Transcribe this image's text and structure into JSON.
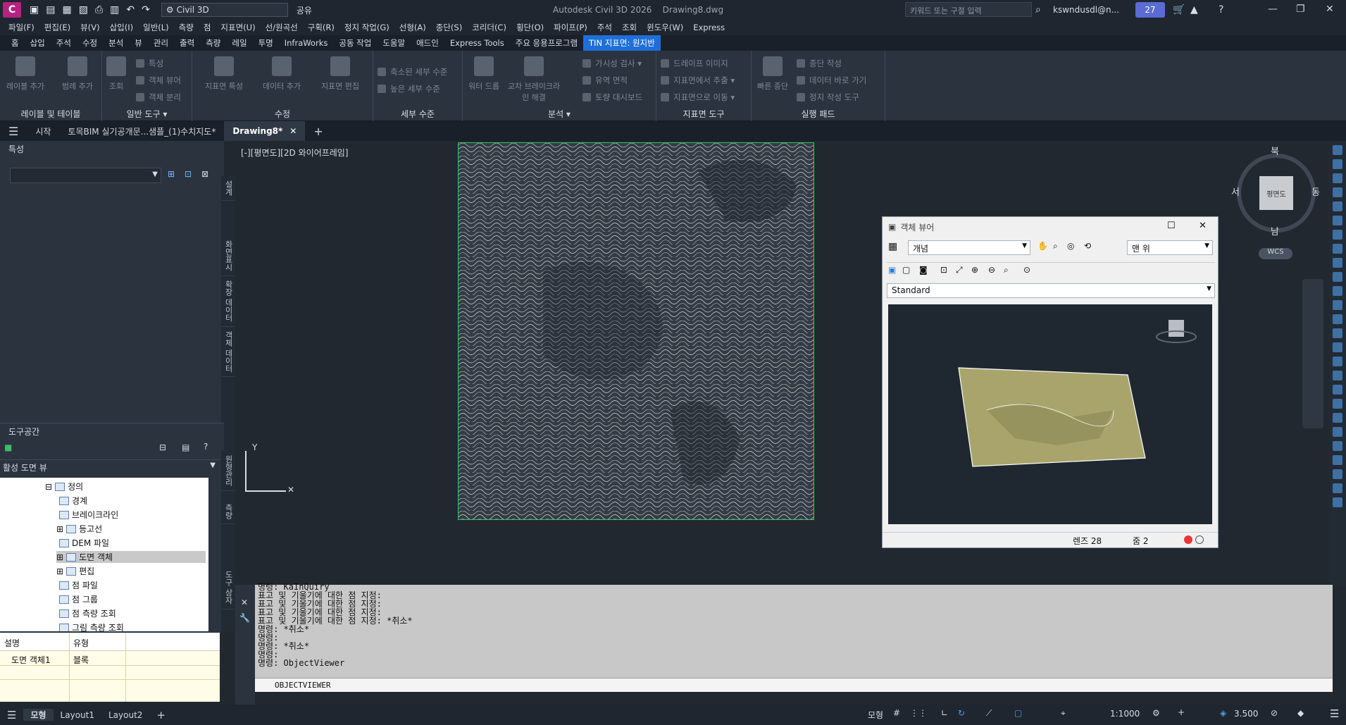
{
  "titlebar": {
    "logo": "C",
    "workspace": "Civil 3D",
    "share": "공유",
    "app_title": "Autodesk Civil 3D 2026",
    "doc_title": "Drawing8.dwg",
    "search_placeholder": "키워드 또는 구절 입력",
    "user": "kswndusdl@n...",
    "notifications": "27"
  },
  "menu": [
    "파일(F)",
    "편집(E)",
    "뷰(V)",
    "삽입(I)",
    "일반(L)",
    "측량",
    "점",
    "지표면(U)",
    "선/원곡선",
    "구획(R)",
    "정지 작업(G)",
    "선형(A)",
    "종단(S)",
    "코리더(C)",
    "횡단(O)",
    "파이프(P)",
    "주석",
    "조회",
    "윈도우(W)",
    "Express"
  ],
  "ribbon_tabs": [
    "홈",
    "삽입",
    "주석",
    "수정",
    "분석",
    "뷰",
    "관리",
    "출력",
    "측량",
    "레일",
    "투명",
    "InfraWorks",
    "공동 작업",
    "도움말",
    "애드인",
    "Express Tools",
    "주요 응용프로그램",
    "TIN 지표면: 원지반"
  ],
  "ribbon": {
    "p1": {
      "title": "레이블 및 테이블",
      "b1": "레이블 추가",
      "b2": "범례 추가"
    },
    "p2": {
      "title": "일반 도구 ▾",
      "b1": "조회",
      "s1": "특성",
      "s2": "객체 뷰어",
      "s3": "객체 분리"
    },
    "p3": {
      "title": "수정",
      "b1": "지표면 특성",
      "b2": "데이터 추가",
      "b3": "지표면 편집"
    },
    "p4": {
      "title": "세부 수준",
      "s1": "축소된 세부 수준",
      "s2": "높은 세부 수준"
    },
    "p5": {
      "title": "분석 ▾",
      "b1": "워터 드롭",
      "b2": "교차 브레이크라인 해결",
      "s1": "가시성 검사 ▾",
      "s2": "유역 면적",
      "s3": "토량 대시보드"
    },
    "p6": {
      "title": "지표면 도구",
      "s1": "드레이프 이미지",
      "s2": "지표면에서 추출 ▾",
      "s3": "지표면으로 이동 ▾"
    },
    "p7": {
      "title": "실행 패드",
      "b1": "빠른 종단",
      "s1": "종단 작성",
      "s2": "데이터 바로 가기",
      "s3": "정지 작성 도구"
    }
  },
  "doc_tabs": [
    "시작",
    "토목BIM 실기공개문...샘플_(1)수치지도*",
    "Drawing8*"
  ],
  "properties": {
    "title": "특성"
  },
  "props_vtabs": [
    "설계",
    "화면표시",
    "확장 데이터",
    "객체 데이터"
  ],
  "toolspace": {
    "title": "도구공간",
    "view": "활성 도면 뷰",
    "vtabs": [
      "원형관리",
      "측량",
      "도구 상자"
    ]
  },
  "tree": [
    {
      "label": "정의",
      "exp": "⊟"
    },
    {
      "label": "경계",
      "exp": ""
    },
    {
      "label": "브레이크라인",
      "exp": ""
    },
    {
      "label": "등고선",
      "exp": "⊞"
    },
    {
      "label": "DEM 파일",
      "exp": ""
    },
    {
      "label": "도면 객체",
      "exp": "⊞"
    },
    {
      "label": "편집",
      "exp": "⊞"
    },
    {
      "label": "점 파일",
      "exp": ""
    },
    {
      "label": "점 그룹",
      "exp": ""
    },
    {
      "label": "점 측량 조회",
      "exp": ""
    },
    {
      "label": "그림 측량 조회",
      "exp": ""
    }
  ],
  "info_table": {
    "h1": "설명",
    "h2": "유형",
    "r1c1": "도면 객체1",
    "r1c2": "블록"
  },
  "viewport": {
    "label": "[-][평면도][2D 와이어프레임]",
    "ucs_y": "Y"
  },
  "navcube": {
    "n": "북",
    "s": "남",
    "e": "동",
    "w": "서",
    "face": "평면도",
    "wcs": "WCS"
  },
  "objviewer": {
    "title": "객체 뷰어",
    "style": "개념",
    "view": "맨 위",
    "visual": "Standard",
    "lens": "렌즈 28",
    "zoom": "줌 2"
  },
  "cmd": {
    "lines": [
      "명령: KaInQuiry",
      "표고 및 기울기에 대한 점 지정:",
      "표고 및 기울기에 대한 점 지정:",
      "표고 및 기울기에 대한 점 지정:",
      "표고 및 기울기에 대한 점 지정: *취소*",
      "명령: *취소*",
      "명령:",
      "명령: *취소*",
      "명령:",
      "명령: ObjectViewer"
    ],
    "input": "OBJECTVIEWER"
  },
  "status": {
    "tabs": [
      "모형",
      "Layout1",
      "Layout2"
    ],
    "model": "모형",
    "scale": "1:1000",
    "value": "3.500"
  }
}
